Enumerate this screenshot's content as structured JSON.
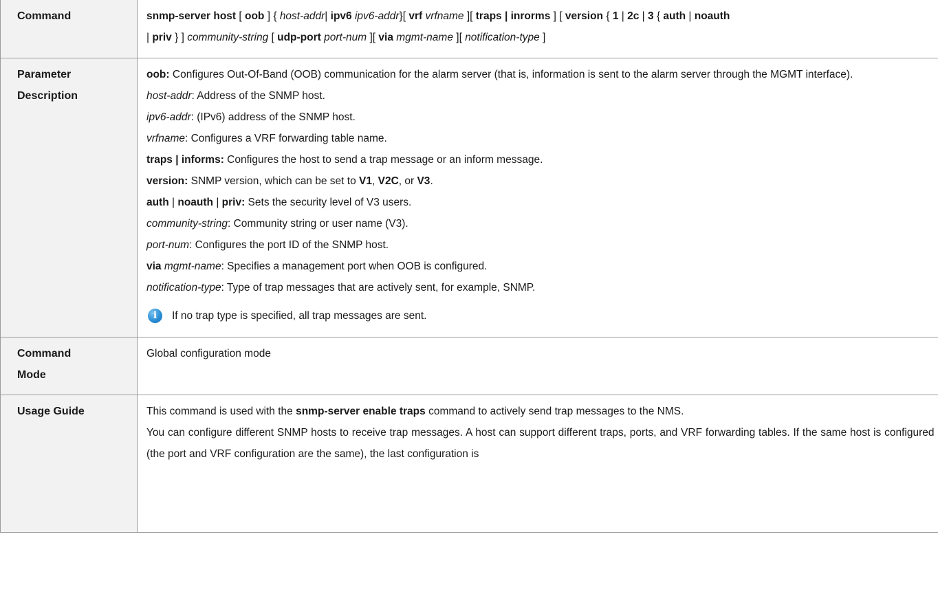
{
  "rows": {
    "command": {
      "label": "Command",
      "syntax": {
        "t1": "snmp-server host",
        "t2": " [ ",
        "t3": "oob",
        "t4": " ] { ",
        "t5": "host-addr",
        "t6": "| ",
        "t7": "ipv6",
        "t8": " ",
        "t9": "ipv6-addr",
        "t10": "}[ ",
        "t11": "vrf",
        "t12": " ",
        "t13": "vrfname",
        "t14": " ][ ",
        "t15": "traps | inrorms",
        "t16": " ] [ ",
        "t17": "version",
        "t18": " { ",
        "t19": "1",
        "t20": " | ",
        "t21": "2c",
        "t22": " | ",
        "t23": "3",
        "t24": " { ",
        "t25": "auth",
        "t26": " | ",
        "t27": "noauth",
        "u1": "| ",
        "u2": "priv",
        "u3": " } ] ",
        "u4": "community-string",
        "u5": " [ ",
        "u6": "udp-port",
        "u7": " ",
        "u8": "port-num",
        "u9": " ][ ",
        "u10": "via",
        "u11": " ",
        "u12": "mgmt-name",
        "u13": " ][ ",
        "u14": "notification-type",
        "u15": " ]"
      }
    },
    "parameter": {
      "label_line1": "Parameter",
      "label_line2": "Description",
      "oob_term": "oob:",
      "oob_desc": " Configures Out-Of-Band (OOB) communication for the alarm server (that is, information is sent to the alarm server through the MGMT interface).",
      "host_term": "host-addr",
      "host_desc": ": Address of the SNMP host.",
      "ipv6_term": "ipv6-addr",
      "ipv6_desc": ": (IPv6) address of the SNMP host.",
      "vrf_term": "vrfname",
      "vrf_desc": ": Configures a VRF forwarding table name.",
      "traps_term": "traps | informs:",
      "traps_desc": " Configures the host to send a trap message or an inform message.",
      "version_term": "version:",
      "version_desc1": " SNMP version, which can be set to ",
      "version_v1": "V1",
      "version_sep1": ", ",
      "version_v2c": "V2C",
      "version_sep2": ", or ",
      "version_v3": "V3",
      "version_end": ".",
      "auth_term1": "auth",
      "auth_sep1": " | ",
      "auth_term2": "noauth",
      "auth_sep2": " | ",
      "auth_term3": "priv:",
      "auth_desc": " Sets the security level of V3 users.",
      "community_term": "community-string",
      "community_desc": ": Community string or user name (V3).",
      "port_term": "port-num",
      "port_desc": ": Configures the port ID of the SNMP host.",
      "via_term": "via",
      "via_space": " ",
      "via_term2": "mgmt-name",
      "via_desc": ": Specifies a management port when OOB is configured.",
      "notif_term": "notification-type",
      "notif_desc": ": Type of trap messages that are actively sent, for example, SNMP.",
      "note_icon": "info-icon",
      "note_text": "If no trap type is specified, all trap messages are sent."
    },
    "mode": {
      "label_line1": "Command",
      "label_line2": "Mode",
      "value": "Global configuration mode"
    },
    "usage": {
      "label": "Usage Guide",
      "p1_a": "This command is used with the ",
      "p1_b": "snmp-server enable traps",
      "p1_c": " command to actively send trap messages to the NMS.",
      "p2": "You can configure different SNMP hosts to receive trap messages. A host can support different traps, ports, and VRF forwarding tables. If the same host is configured (the port and VRF configuration are the same), the last configuration is"
    }
  }
}
